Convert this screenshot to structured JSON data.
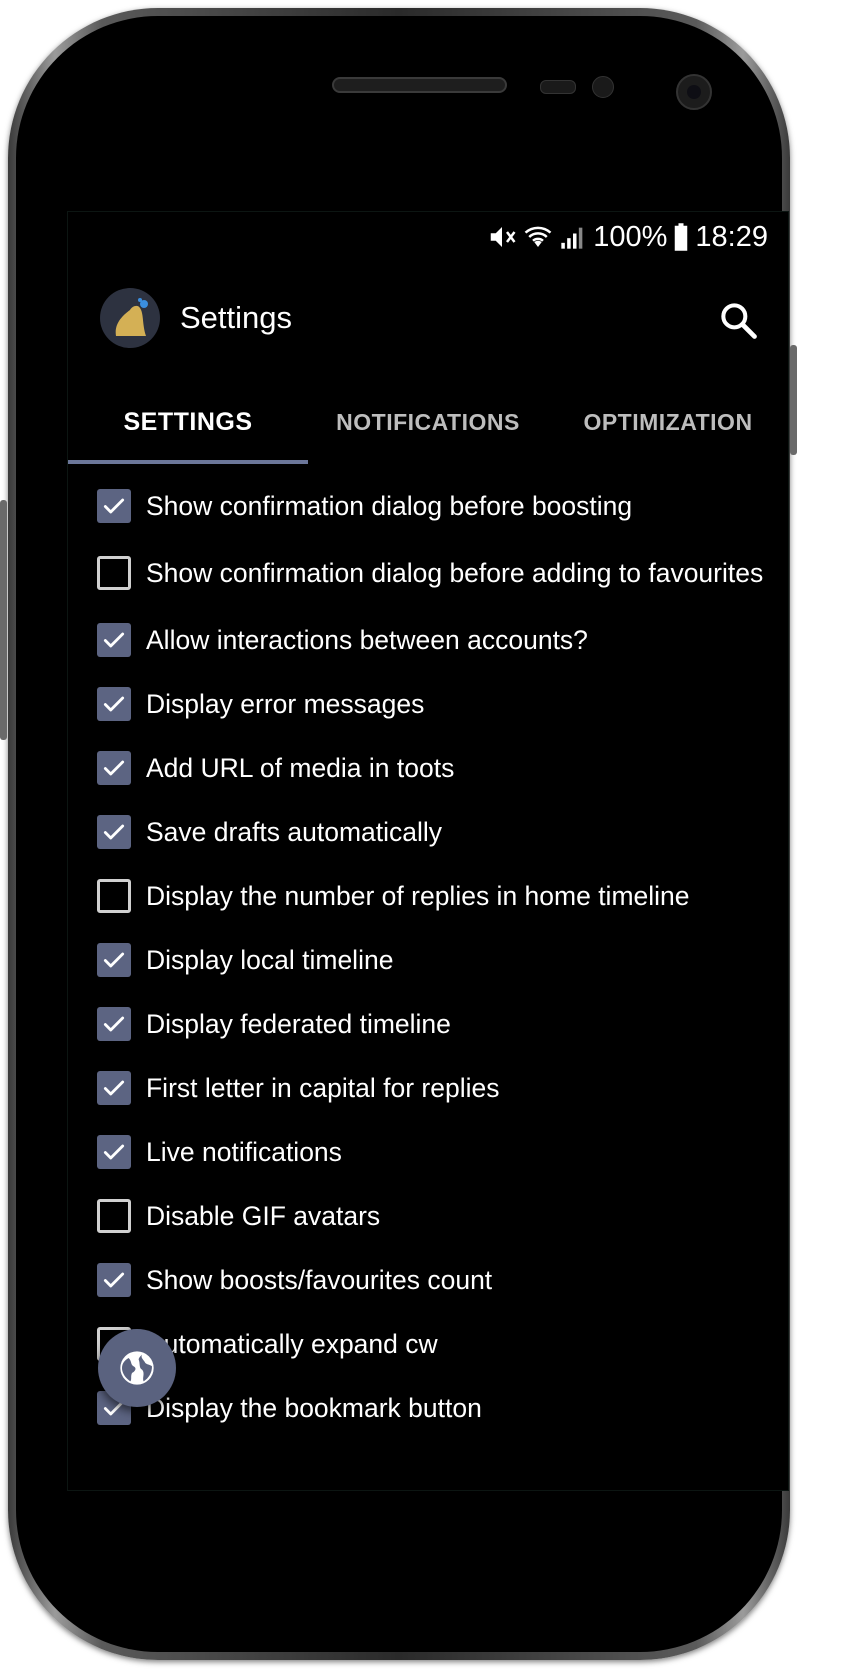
{
  "status_bar": {
    "battery_percent": "100%",
    "time": "18:29",
    "icons": [
      "mute-icon",
      "wifi-icon",
      "signal-icon",
      "battery-icon"
    ]
  },
  "app_bar": {
    "title": "Settings",
    "logo_icon": "app-logo-icon",
    "search_icon": "search-icon"
  },
  "tabs": [
    {
      "label": "SETTINGS",
      "active": true
    },
    {
      "label": "NOTIFICATIONS",
      "active": false
    },
    {
      "label": "OPTIMIZATION",
      "active": false
    }
  ],
  "settings": [
    {
      "label": "Show confirmation dialog before boosting",
      "checked": true
    },
    {
      "label": "Show confirmation dialog before adding to favourites",
      "checked": false
    },
    {
      "label": "Allow interactions between accounts?",
      "checked": true
    },
    {
      "label": "Display error messages",
      "checked": true
    },
    {
      "label": "Add URL of media in toots",
      "checked": true
    },
    {
      "label": "Save drafts automatically",
      "checked": true
    },
    {
      "label": "Display the number of replies in home timeline",
      "checked": false
    },
    {
      "label": "Display local timeline",
      "checked": true
    },
    {
      "label": "Display federated timeline",
      "checked": true
    },
    {
      "label": "First letter in capital for replies",
      "checked": true
    },
    {
      "label": "Live notifications",
      "checked": true
    },
    {
      "label": "Disable GIF avatars",
      "checked": false
    },
    {
      "label": "Show boosts/favourites count",
      "checked": true
    },
    {
      "label": "Automatically expand cw",
      "checked": false
    },
    {
      "label": "Display the bookmark button",
      "checked": true
    }
  ],
  "fab": {
    "icon": "globe-icon"
  },
  "colors": {
    "accent": "#6b7699",
    "checkbox_checked": "#5c6482",
    "fab": "#5a627f",
    "background": "#000000"
  }
}
